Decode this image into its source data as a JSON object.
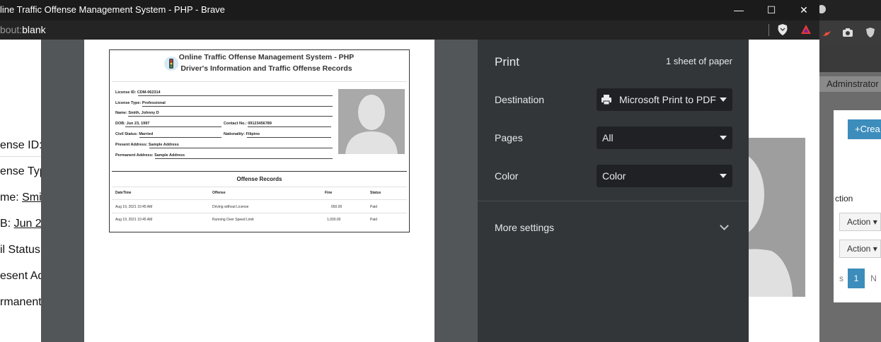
{
  "window": {
    "title": "line Traffic Offense Management System - PHP - Brave",
    "minimize_glyph": "—",
    "maximize_glyph": "☐",
    "close_glyph": "✕"
  },
  "address_bar": {
    "url_prefix": "bout:",
    "url_main": "blank",
    "icons": [
      "brave-shield-icon",
      "brave-rewards-icon"
    ]
  },
  "background_page": {
    "labels": [
      {
        "prefix": "ense ID: ",
        "value": ""
      },
      {
        "prefix": "ense Typ",
        "value": ""
      },
      {
        "prefix": "me: ",
        "value": "Smi"
      },
      {
        "prefix": "B: ",
        "value": "Jun 2"
      },
      {
        "prefix": "il Status:",
        "value": ""
      },
      {
        "prefix": "esent Add",
        "value": ""
      },
      {
        "prefix": "rmanent",
        "value": ""
      }
    ]
  },
  "second_window": {
    "admin_label": "Adminstrator",
    "create_label": "+Crea",
    "table_header": "ction",
    "action_label": "Action",
    "pagination": [
      "s",
      "1",
      "N"
    ]
  },
  "print_dialog": {
    "title": "Print",
    "sheets": "1 sheet of paper",
    "destination_label": "Destination",
    "destination_value": "Microsoft Print to PDF",
    "pages_label": "Pages",
    "pages_value": "All",
    "color_label": "Color",
    "color_value": "Color",
    "more_settings": "More settings"
  },
  "document": {
    "title_line1": "Online Traffic Offense Management System - PHP",
    "title_line2": "Driver's Information and Traffic Offense Records",
    "fields": {
      "license_id_label": "License ID:",
      "license_id": "CDM-062314",
      "license_type_label": "License Type:",
      "license_type": "Professional",
      "name_label": "Name:",
      "name": "Smith, Johnny D",
      "dob_label": "DOB:",
      "dob": "Jun 23, 1997",
      "contact_label": "Contact No.:",
      "contact": "09123456789",
      "civil_status_label": "Civil Status:",
      "civil_status": "Married",
      "nationality_label": "Nationality:",
      "nationality": "Filipino",
      "present_address_label": "Present Address:",
      "present_address": "Sample Address",
      "permanent_address_label": "Permanent Address:",
      "permanent_address": "Sample Address"
    },
    "offense_section_title": "Offense Records",
    "offense_table": {
      "headers": [
        "DateTime",
        "Offense",
        "Fine",
        "Status"
      ],
      "rows": [
        [
          "Aug 19, 2021 10:45 AM",
          "Driving without License",
          "650.00",
          "Paid"
        ],
        [
          "Aug 19, 2021 10:45 AM",
          "Running Over Speed Limit",
          "1,000.00",
          "Paid"
        ]
      ]
    }
  },
  "colors": {
    "print_panel_bg": "#323639",
    "select_bg": "#202124",
    "overlay_bg": "#525659",
    "accent_blue": "#3c8dbc"
  }
}
